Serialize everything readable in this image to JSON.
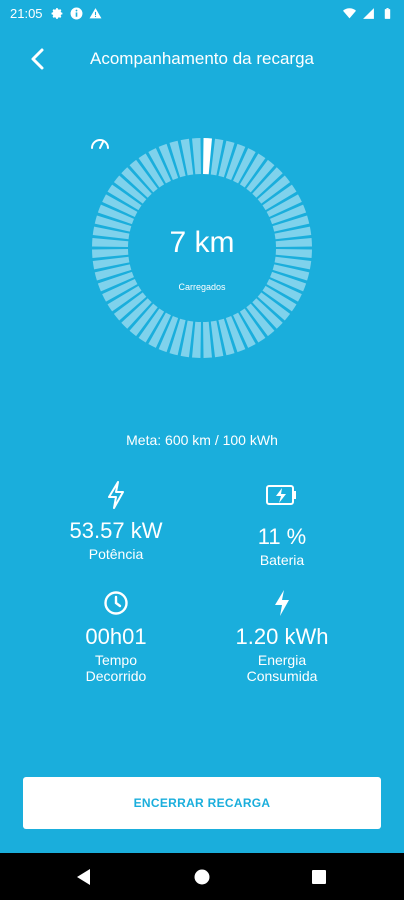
{
  "status_bar": {
    "time": "21:05",
    "left_icons": [
      "gear-icon",
      "info-icon",
      "warning-icon"
    ],
    "right_icons": [
      "wifi-icon",
      "signal-icon",
      "battery-icon"
    ]
  },
  "header": {
    "back_icon": "chevron-left-icon",
    "title": "Acompanhamento da recarga"
  },
  "gauge": {
    "icon": "speedometer-icon",
    "value": "7 km",
    "label": "Carregados",
    "segments": 60,
    "progress_fraction": 0.0117,
    "colors": {
      "track": "#7fd2ec",
      "active": "#ffffff"
    }
  },
  "goal_text": "Meta: 600 km / 100 kWh",
  "metrics": {
    "power": {
      "icon": "lightning-icon",
      "value": "53.57 kW",
      "label": "Potência"
    },
    "battery": {
      "icon": "battery-charging-icon",
      "value": "11 %",
      "label": "Bateria"
    },
    "elapsed": {
      "icon": "clock-icon",
      "value": "00h01",
      "label_line1": "Tempo",
      "label_line2": "Decorrido"
    },
    "energy": {
      "icon": "lightning-icon",
      "value": "1.20 kWh",
      "label_line1": "Energia",
      "label_line2": "Consumida"
    }
  },
  "end_button": {
    "label": "ENCERRAR RECARGA"
  },
  "nav": {
    "back": "back-triangle-icon",
    "home": "home-circle-icon",
    "recents": "recents-square-icon"
  },
  "colors": {
    "background": "#1aaedc",
    "nav_bar": "#000000",
    "button_bg": "#ffffff",
    "button_text": "#1aaedc"
  }
}
